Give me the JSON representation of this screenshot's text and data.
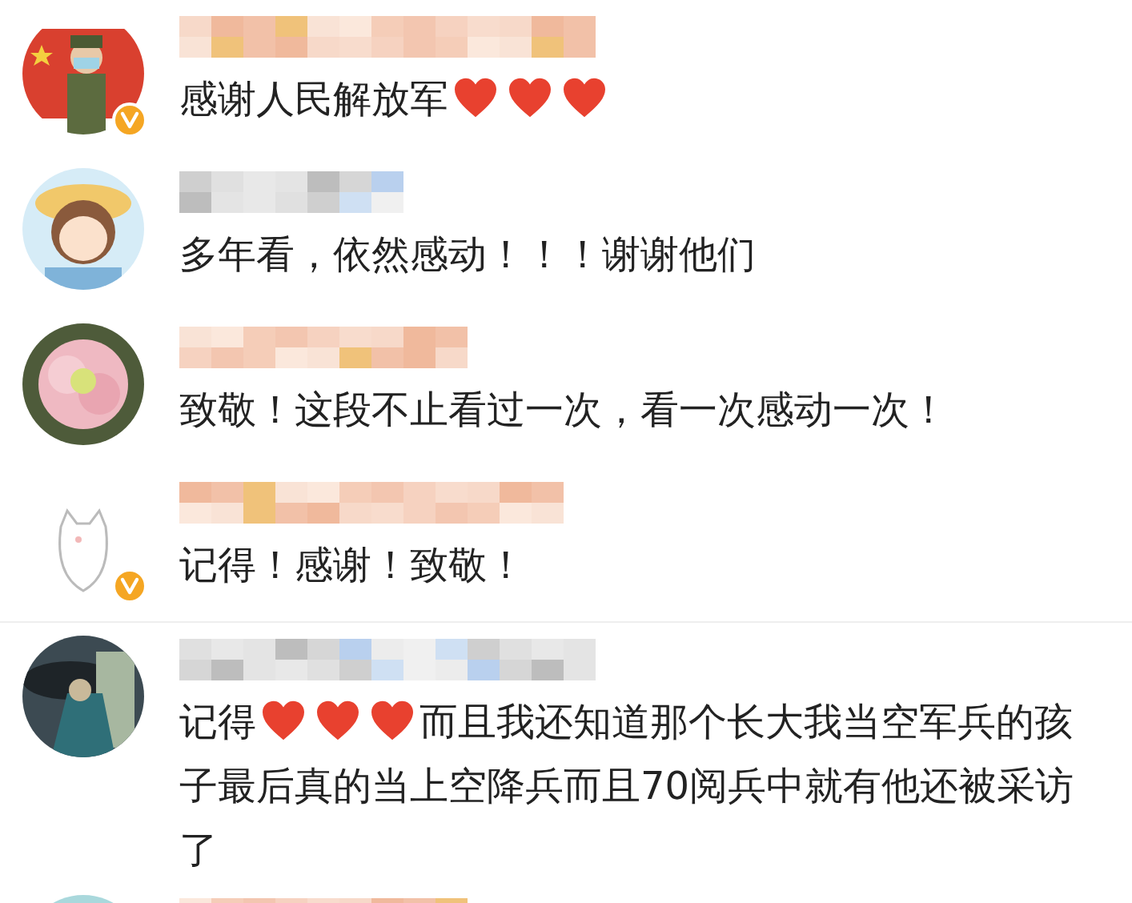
{
  "comments": [
    {
      "avatar": {
        "kind": "flag"
      },
      "verified": true,
      "divider": false,
      "segments": [
        {
          "kind": "text",
          "text": "感谢人民解放军"
        },
        {
          "kind": "heart"
        },
        {
          "kind": "heart"
        },
        {
          "kind": "heart"
        }
      ]
    },
    {
      "avatar": {
        "kind": "cartoon"
      },
      "verified": false,
      "divider": false,
      "segments": [
        {
          "kind": "text",
          "text": "多年看，依然感动！！！谢谢他们"
        }
      ]
    },
    {
      "avatar": {
        "kind": "flower"
      },
      "verified": false,
      "divider": false,
      "segments": [
        {
          "kind": "text",
          "text": "致敬！这段不止看过一次，看一次感动一次！"
        }
      ]
    },
    {
      "avatar": {
        "kind": "cat"
      },
      "verified": true,
      "divider": true,
      "segments": [
        {
          "kind": "text",
          "text": "记得！感谢！致敬！"
        }
      ]
    },
    {
      "avatar": {
        "kind": "dark"
      },
      "verified": false,
      "divider": false,
      "segments": [
        {
          "kind": "text",
          "text": "记得"
        },
        {
          "kind": "heart"
        },
        {
          "kind": "heart"
        },
        {
          "kind": "heart"
        },
        {
          "kind": "text",
          "text": "而且我还知道那个长大我当空军兵的孩子最后真的当上空降兵而且70阅兵中就有他还被采访了"
        }
      ]
    },
    {
      "avatar": {
        "kind": "sky"
      }
    }
  ]
}
